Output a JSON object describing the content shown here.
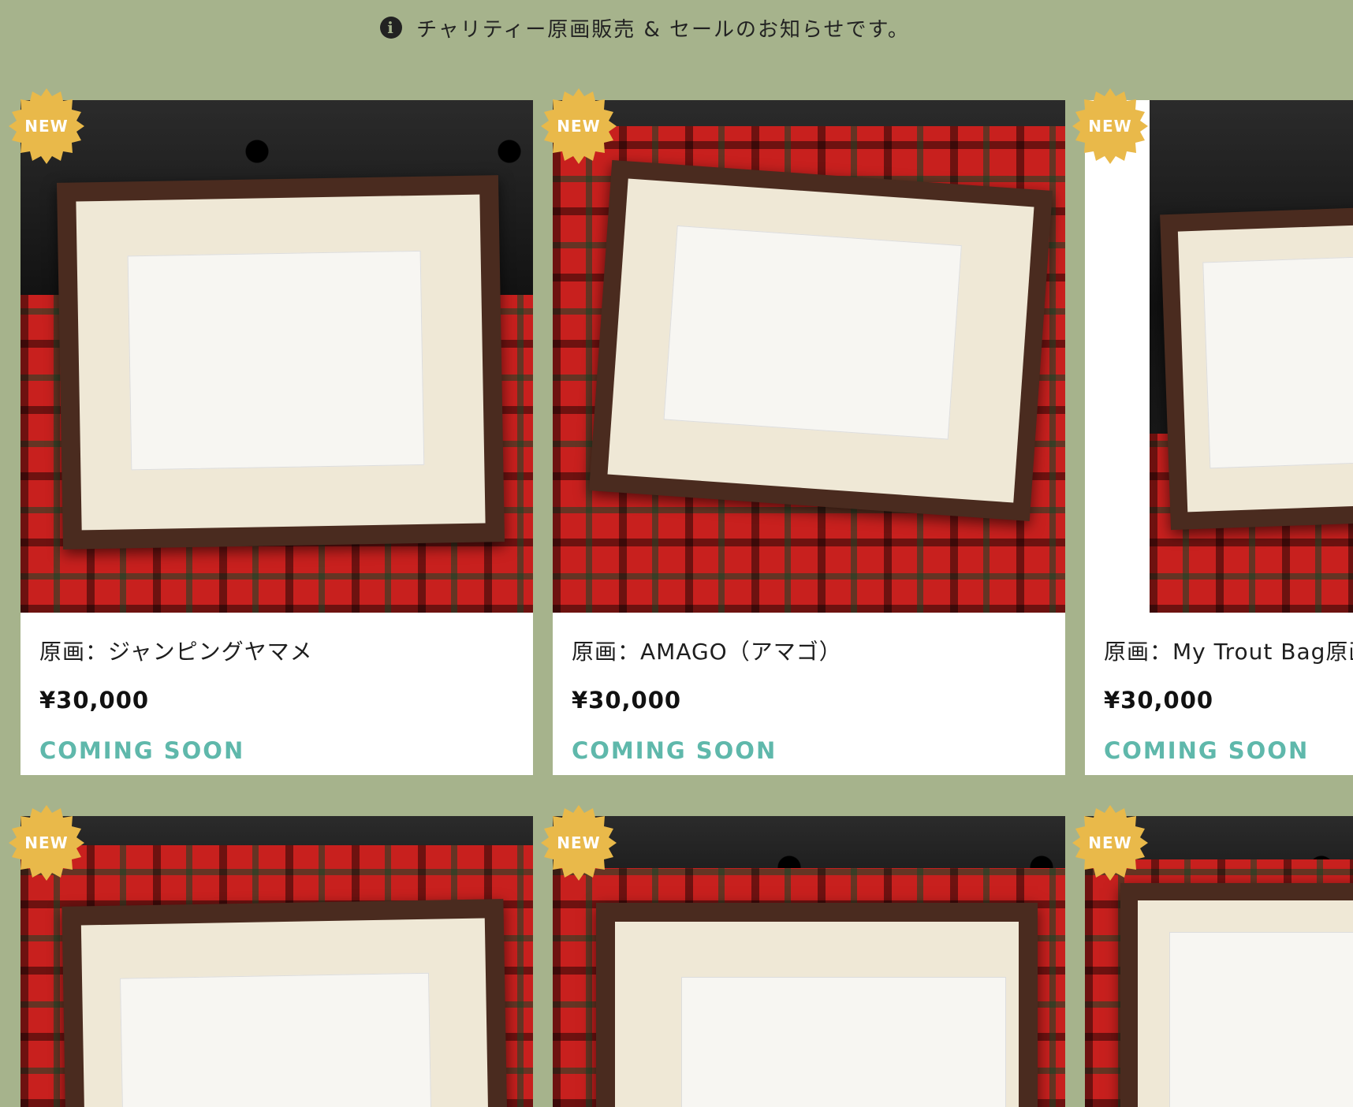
{
  "notice": {
    "text": "チャリティー原画販売 & セールのお知らせです。",
    "icon": "info-icon"
  },
  "badge_label": "NEW",
  "colors": {
    "background": "#a6b38c",
    "badge": "#e9b94a",
    "coming_soon": "#5fb8ab"
  },
  "products": [
    {
      "title": "原画：ジャンピングヤマメ",
      "price": "¥30,000",
      "status": "COMING SOON"
    },
    {
      "title": "原画：AMAGO（アマゴ）",
      "price": "¥30,000",
      "status": "COMING SOON"
    },
    {
      "title": "原画：My Trout Bag原画",
      "price": "¥30,000",
      "status": "COMING SOON"
    },
    {
      "title": "",
      "price": "",
      "status": ""
    },
    {
      "title": "",
      "price": "",
      "status": ""
    },
    {
      "title": "",
      "price": "",
      "status": ""
    }
  ]
}
